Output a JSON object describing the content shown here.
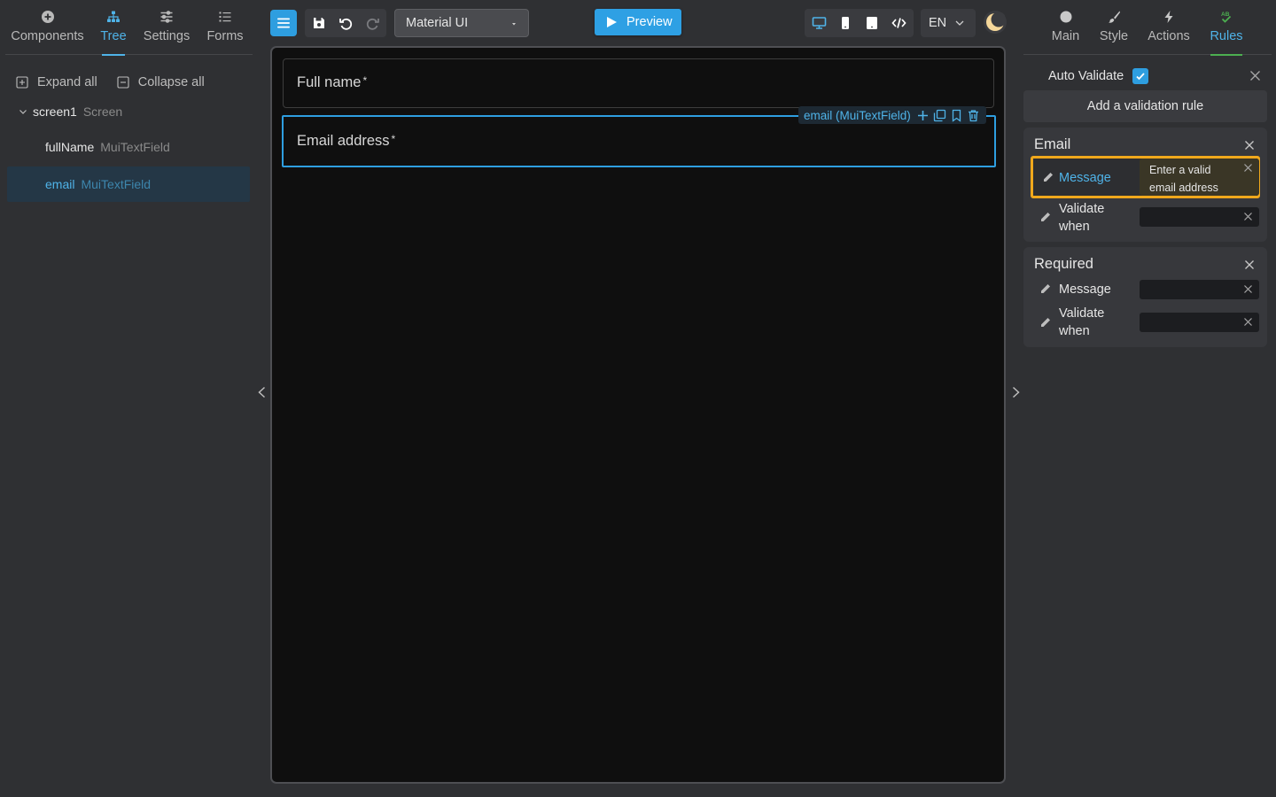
{
  "left_tabs": [
    {
      "label": "Components",
      "icon": "plus-circle-icon"
    },
    {
      "label": "Tree",
      "icon": "hierarchy-icon"
    },
    {
      "label": "Settings",
      "icon": "sliders-icon"
    },
    {
      "label": "Forms",
      "icon": "list-icon"
    }
  ],
  "tree_actions": {
    "expand_all": "Expand all",
    "collapse_all": "Collapse all"
  },
  "tree": {
    "screen": {
      "name": "screen1",
      "type": "Screen"
    },
    "nodes": [
      {
        "name": "fullName",
        "type": "MuiTextField"
      },
      {
        "name": "email",
        "type": "MuiTextField"
      }
    ]
  },
  "toolbar": {
    "library": "Material UI",
    "preview_label": "Preview",
    "language": "EN"
  },
  "canvas": {
    "fields": [
      {
        "label": "Full name",
        "required_mark": "*"
      },
      {
        "label": "Email address",
        "required_mark": "*"
      }
    ],
    "selection_label": "email (MuiTextField)"
  },
  "right_tabs": [
    {
      "label": "Main",
      "icon": "circle-icon"
    },
    {
      "label": "Style",
      "icon": "brush-icon"
    },
    {
      "label": "Actions",
      "icon": "bolt-icon"
    },
    {
      "label": "Rules",
      "icon": "ab-check-icon"
    }
  ],
  "rules_panel": {
    "auto_validate_label": "Auto Validate",
    "auto_validate_checked": true,
    "add_rule_label": "Add a validation rule",
    "rules": [
      {
        "title": "Email",
        "props": [
          {
            "label": "Message",
            "value": "Enter a valid email address"
          },
          {
            "label": "Validate when",
            "value": ""
          }
        ]
      },
      {
        "title": "Required",
        "props": [
          {
            "label": "Message",
            "value": ""
          },
          {
            "label": "Validate when",
            "value": ""
          }
        ]
      }
    ]
  },
  "colors": {
    "accent": "#2e9ee0",
    "highlight": "#f0a81c",
    "rules_tab_underline": "#4caf50"
  }
}
